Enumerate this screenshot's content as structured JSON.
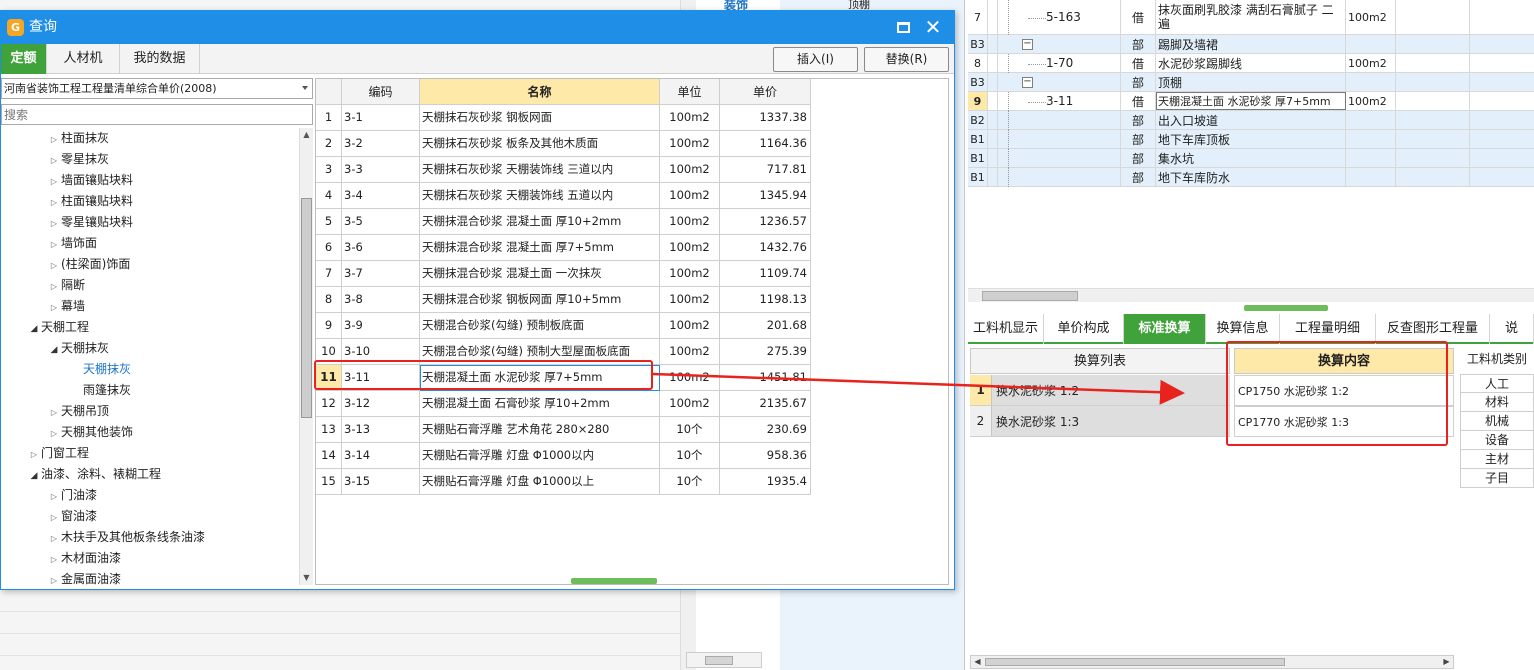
{
  "dialog": {
    "title": "查询",
    "tabs": [
      "定额",
      "人材机",
      "我的数据"
    ],
    "insert_button": "插入(I)",
    "replace_button": "替换(R)",
    "library_select": "河南省装饰工程工程量清单综合单价(2008)",
    "search_placeholder": "搜索"
  },
  "tree": [
    {
      "label": "柱面抹灰",
      "level": 2,
      "state": "closed"
    },
    {
      "label": "零星抹灰",
      "level": 2,
      "state": "closed"
    },
    {
      "label": "墙面镶贴块料",
      "level": 2,
      "state": "closed"
    },
    {
      "label": "柱面镶贴块料",
      "level": 2,
      "state": "closed"
    },
    {
      "label": "零星镶贴块料",
      "level": 2,
      "state": "closed"
    },
    {
      "label": "墙饰面",
      "level": 2,
      "state": "closed"
    },
    {
      "label": "(柱梁面)饰面",
      "level": 2,
      "state": "closed"
    },
    {
      "label": "隔断",
      "level": 2,
      "state": "closed"
    },
    {
      "label": "幕墙",
      "level": 2,
      "state": "closed"
    },
    {
      "label": "天棚工程",
      "level": 1,
      "state": "open"
    },
    {
      "label": "天棚抹灰",
      "level": 2,
      "state": "open"
    },
    {
      "label": "天棚抹灰",
      "level": 3,
      "state": "leaf",
      "selected": true
    },
    {
      "label": "雨篷抹灰",
      "level": 3,
      "state": "leaf"
    },
    {
      "label": "天棚吊顶",
      "level": 2,
      "state": "closed"
    },
    {
      "label": "天棚其他装饰",
      "level": 2,
      "state": "closed"
    },
    {
      "label": "门窗工程",
      "level": 1,
      "state": "closed"
    },
    {
      "label": "油漆、涂料、裱糊工程",
      "level": 1,
      "state": "open"
    },
    {
      "label": "门油漆",
      "level": 2,
      "state": "closed"
    },
    {
      "label": "窗油漆",
      "level": 2,
      "state": "closed"
    },
    {
      "label": "木扶手及其他板条线条油漆",
      "level": 2,
      "state": "closed"
    },
    {
      "label": "木材面油漆",
      "level": 2,
      "state": "closed"
    },
    {
      "label": "金属面油漆",
      "level": 2,
      "state": "closed"
    }
  ],
  "grid": {
    "headers": {
      "code": "编码",
      "name": "名称",
      "unit": "单位",
      "price": "单价"
    },
    "selected_row": 11,
    "rows": [
      {
        "idx": "1",
        "code": "3-1",
        "name": "天棚抹石灰砂浆 钢板网面",
        "unit": "100m2",
        "price": "1337.38"
      },
      {
        "idx": "2",
        "code": "3-2",
        "name": "天棚抹石灰砂浆 板条及其他木质面",
        "unit": "100m2",
        "price": "1164.36"
      },
      {
        "idx": "3",
        "code": "3-3",
        "name": "天棚抹石灰砂浆 天棚装饰线 三道以内",
        "unit": "100m2",
        "price": "717.81"
      },
      {
        "idx": "4",
        "code": "3-4",
        "name": "天棚抹石灰砂浆 天棚装饰线 五道以内",
        "unit": "100m2",
        "price": "1345.94"
      },
      {
        "idx": "5",
        "code": "3-5",
        "name": "天棚抹混合砂浆 混凝土面 厚10+2mm",
        "unit": "100m2",
        "price": "1236.57"
      },
      {
        "idx": "6",
        "code": "3-6",
        "name": "天棚抹混合砂浆 混凝土面 厚7+5mm",
        "unit": "100m2",
        "price": "1432.76"
      },
      {
        "idx": "7",
        "code": "3-7",
        "name": "天棚抹混合砂浆 混凝土面 一次抹灰",
        "unit": "100m2",
        "price": "1109.74"
      },
      {
        "idx": "8",
        "code": "3-8",
        "name": "天棚抹混合砂浆 钢板网面 厚10+5mm",
        "unit": "100m2",
        "price": "1198.13"
      },
      {
        "idx": "9",
        "code": "3-9",
        "name": "天棚混合砂浆(勾缝) 预制板底面",
        "unit": "100m2",
        "price": "201.68"
      },
      {
        "idx": "10",
        "code": "3-10",
        "name": "天棚混合砂浆(勾缝) 预制大型屋面板底面",
        "unit": "100m2",
        "price": "275.39"
      },
      {
        "idx": "11",
        "code": "3-11",
        "name": "天棚混凝土面 水泥砂浆 厚7+5mm",
        "unit": "100m2",
        "price": "1451.81"
      },
      {
        "idx": "12",
        "code": "3-12",
        "name": "天棚混凝土面 石膏砂浆 厚10+2mm",
        "unit": "100m2",
        "price": "2135.67"
      },
      {
        "idx": "13",
        "code": "3-13",
        "name": "天棚贴石膏浮雕 艺术角花 280×280",
        "unit": "10个",
        "price": "230.69"
      },
      {
        "idx": "14",
        "code": "3-14",
        "name": "天棚贴石膏浮雕 灯盘 Φ1000以内",
        "unit": "10个",
        "price": "958.36"
      },
      {
        "idx": "15",
        "code": "3-15",
        "name": "天棚贴石膏浮雕 灯盘 Φ1000以上",
        "unit": "10个",
        "price": "1935.4"
      }
    ]
  },
  "background": {
    "link_text": "装饰",
    "tree_text": "顶棚"
  },
  "right_table": {
    "rows": [
      {
        "num": "7",
        "code": "5-163",
        "type": "借",
        "name": "抹灰面刷乳胶漆 满刮石膏腻子 二遍",
        "unit": "100m2",
        "style": "white"
      },
      {
        "num": "B3",
        "code": "",
        "type": "部",
        "name": "踢脚及墙裙",
        "unit": "",
        "style": "blue",
        "minus": true
      },
      {
        "num": "8",
        "code": "1-70",
        "type": "借",
        "name": "水泥砂浆踢脚线",
        "unit": "100m2",
        "style": "white"
      },
      {
        "num": "B3",
        "code": "",
        "type": "部",
        "name": "顶棚",
        "unit": "",
        "style": "blue",
        "minus": true
      },
      {
        "num": "9",
        "code": "3-11",
        "type": "借",
        "name": "天棚混凝土面 水泥砂浆 厚7+5mm",
        "unit": "100m2",
        "style": "white",
        "selected": true
      },
      {
        "num": "B2",
        "code": "",
        "type": "部",
        "name": "出入口坡道",
        "unit": "",
        "style": "blue"
      },
      {
        "num": "B1",
        "code": "",
        "type": "部",
        "name": "地下车库顶板",
        "unit": "",
        "style": "blue"
      },
      {
        "num": "B1",
        "code": "",
        "type": "部",
        "name": "集水坑",
        "unit": "",
        "style": "blue"
      },
      {
        "num": "B1",
        "code": "",
        "type": "部",
        "name": "地下车库防水",
        "unit": "",
        "style": "blue"
      }
    ]
  },
  "bottom_tabs": [
    "工料机显示",
    "单价构成",
    "标准换算",
    "换算信息",
    "工程量明细",
    "反查图形工程量",
    "说"
  ],
  "active_bottom_tab": "标准换算",
  "conversion": {
    "list_header": "换算列表",
    "content_header": "换算内容",
    "rows": [
      {
        "idx": "1",
        "label": "换水泥砂浆 1:2",
        "content": "CP1750  水泥砂浆 1:2"
      },
      {
        "idx": "2",
        "label": "换水泥砂浆 1:3",
        "content": "CP1770  水泥砂浆 1:3"
      }
    ]
  },
  "category": {
    "header": "工料机类别",
    "items": [
      "人工",
      "材料",
      "机械",
      "设备",
      "主材",
      "子目"
    ]
  },
  "colors": {
    "title_bar": "#1e8ee6",
    "active_tab": "#3fa23a",
    "header_highlight": "#ffe9a8",
    "annotation": "#e8231e",
    "blue_row": "#e3f0fb"
  }
}
